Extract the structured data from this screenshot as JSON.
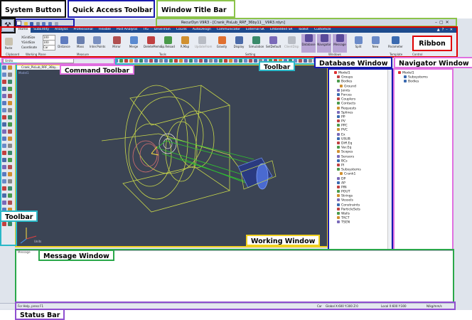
{
  "callouts": {
    "system_button": "System Button",
    "quick_access": "Quick Access Toolbar",
    "window_title_bar": "Window Title Bar",
    "ribbon": "Ribbon",
    "command_toolbar": "Command Toolbar",
    "toolbar_top": "Toolbar",
    "database_window": "Database Window",
    "navigator_window": "Navigator Window",
    "toolbar_left": "Toolbar",
    "working_window": "Working  Window",
    "message_window": "Message Window",
    "status_bar": "Status Bar"
  },
  "app": {
    "title": "RecurDyn V9R3 - [Crank_PisLub_RRF_36by11__V9R3.rdyn]",
    "tabs": [
      "Home",
      "SubEntity",
      "Analysis",
      "Professional",
      "Flexible",
      "Post Analysis",
      "TIG",
      "DriveTrain",
      "CoLink",
      "AutoDesign",
      "Communicator",
      "External SK",
      "Embedded SR",
      "Toolkit",
      "Customize"
    ],
    "active_tab": "Home"
  },
  "ribbon": {
    "groups": [
      "Clipboard",
      "Working Plane",
      "Measure",
      "Tools",
      "Setting",
      "Windows",
      "Template",
      "Control"
    ],
    "buttons": [
      "Paste",
      "Distance",
      "Mass",
      "Inter.Points",
      "Mirror",
      "Merge",
      "DeleteMemo",
      "Sp.Reload",
      "R.Map",
      "UpdateFrom",
      "Gravity",
      "Display",
      "Simulation",
      "SetDefault",
      "ClientDisp",
      "Database",
      "Navigator",
      "Message",
      "Split",
      "New",
      "Parameter"
    ],
    "fields": [
      "XGridSize",
      "YGridSize",
      "Coordinate"
    ],
    "field_values": [
      "100",
      "100",
      "Car"
    ]
  },
  "command_bar": {
    "value": "Units"
  },
  "working": {
    "tab_title": "Crank_PisLub_RRF_36by...",
    "model_label": "Model1",
    "axis_label": "Units"
  },
  "database": {
    "items": [
      "Model1",
      "Groups",
      "Bodies",
      "Ground",
      "Joints",
      "Forces",
      "Couplers",
      "Contacts",
      "Requests",
      "Splines",
      "PP",
      "PV",
      "PPC",
      "PVC",
      "Ex",
      "USUB",
      "Diff.Eq",
      "Var.Eq",
      "Scopes",
      "Sensors",
      "BCs",
      "PI",
      "Subsystems",
      "Crank1",
      "DP",
      "AP",
      "PIN",
      "POUT",
      "Strings",
      "Vessels",
      "Constraints",
      "ParticleSets",
      "Walls",
      "TACT",
      "TSEN"
    ]
  },
  "navigator": {
    "items": [
      "Model1",
      "Subsystems",
      "Bodies"
    ]
  },
  "message": {
    "header": "Message"
  },
  "status": {
    "help": "For Help, press F1",
    "car": "Car",
    "global": "Global  X:600 Y:300 Z:0",
    "local": "Local   X:600 Y:300",
    "units": "N/kg/mm/s"
  },
  "colors": {
    "ribbon_tabs_bg": "#1d4a8c",
    "viewport_bg": "#3b4454",
    "frame_green": "#8bc34a",
    "frame_blue": "#1a1ab0",
    "frame_red": "#e00000",
    "frame_pink": "#e070e0",
    "frame_teal": "#2ab8c8",
    "frame_yellow": "#f0d020",
    "frame_msg": "#2aa84a",
    "frame_purple": "#9050d0"
  }
}
